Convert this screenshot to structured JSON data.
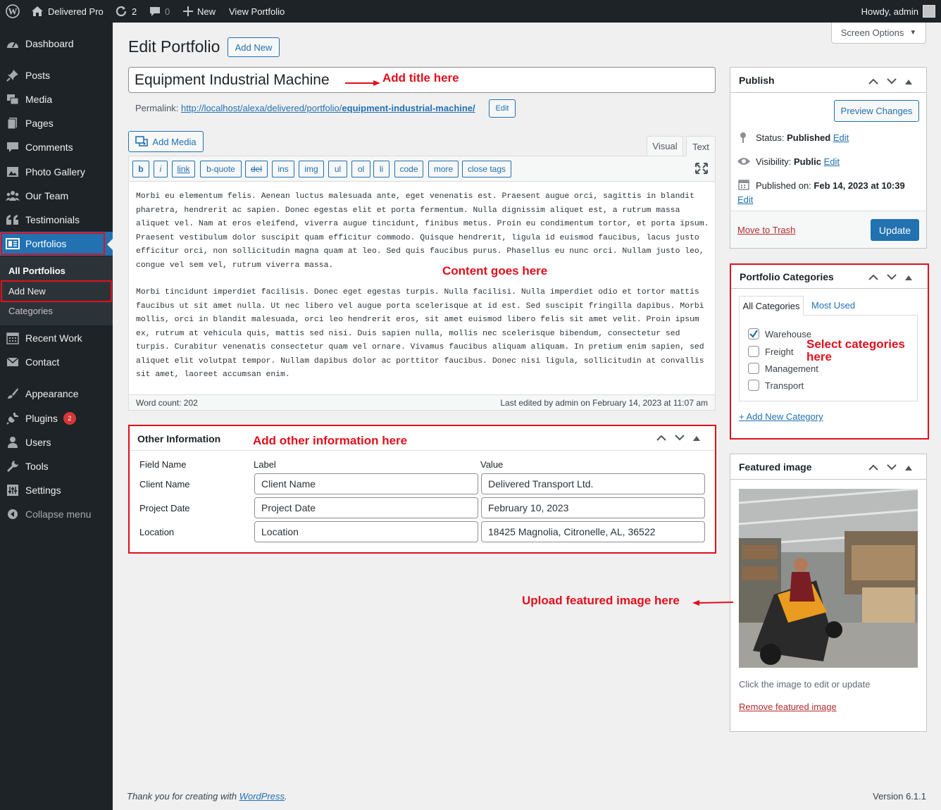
{
  "adminbar": {
    "site_name": "Delivered Pro",
    "updates_count": "2",
    "comments_count": "0",
    "new_label": "New",
    "view_label": "View Portfolio",
    "howdy": "Howdy, admin"
  },
  "sidebar": {
    "items": [
      {
        "label": "Dashboard",
        "icon": "dashboard-icon"
      },
      {
        "label": "Posts",
        "icon": "pin-icon"
      },
      {
        "label": "Media",
        "icon": "media-icon"
      },
      {
        "label": "Pages",
        "icon": "pages-icon"
      },
      {
        "label": "Comments",
        "icon": "comments-icon"
      },
      {
        "label": "Photo Gallery",
        "icon": "gallery-icon"
      },
      {
        "label": "Our Team",
        "icon": "team-icon"
      },
      {
        "label": "Testimonials",
        "icon": "quote-icon"
      },
      {
        "label": "Portfolios",
        "icon": "portfolio-icon"
      },
      {
        "label": "Recent Work",
        "icon": "calendar-icon"
      },
      {
        "label": "Contact",
        "icon": "mail-icon"
      },
      {
        "label": "Appearance",
        "icon": "brush-icon"
      },
      {
        "label": "Plugins",
        "icon": "plug-icon",
        "badge": "2"
      },
      {
        "label": "Users",
        "icon": "user-icon"
      },
      {
        "label": "Tools",
        "icon": "wrench-icon"
      },
      {
        "label": "Settings",
        "icon": "settings-icon"
      },
      {
        "label": "Collapse menu",
        "icon": "collapse-icon"
      }
    ],
    "submenu": [
      "All Portfolios",
      "Add New",
      "Categories"
    ]
  },
  "screen_options": "Screen Options",
  "page": {
    "title": "Edit Portfolio",
    "add_new": "Add New",
    "post_title": "Equipment Industrial Machine",
    "permalink_label": "Permalink:",
    "permalink_base": "http://localhost/alexa/delivered/portfolio/",
    "permalink_slug": "equipment-industrial-machine/",
    "permalink_edit": "Edit"
  },
  "editor": {
    "add_media": "Add Media",
    "tab_visual": "Visual",
    "tab_text": "Text",
    "quicktags": [
      "b",
      "i",
      "link",
      "b-quote",
      "del",
      "ins",
      "img",
      "ul",
      "ol",
      "li",
      "code",
      "more",
      "close tags"
    ],
    "paragraph1": "Morbi eu elementum felis. Aenean luctus malesuada ante, eget venenatis est. Praesent augue orci, sagittis in blandit pharetra, hendrerit ac sapien. Donec egestas elit et porta fermentum. Nulla dignissim aliquet est, a rutrum massa aliquet vel. Nam at eros eleifend, viverra augue tincidunt, finibus metus. Proin eu condimentum tortor, et porta ipsum. Praesent vestibulum dolor suscipit quam efficitur commodo. Quisque hendrerit, ligula id euismod faucibus, lacus justo efficitur orci, non sollicitudin magna quam at leo. Sed quis faucibus purus. Phasellus eu nunc orci. Nullam justo leo, congue vel sem vel, rutrum viverra massa.",
    "paragraph2": "Morbi tincidunt imperdiet facilisis. Donec eget egestas turpis. Nulla facilisi. Nulla imperdiet odio et tortor mattis faucibus ut sit amet nulla. Ut nec libero vel augue porta scelerisque at id est. Sed suscipit fringilla dapibus. Morbi mollis, orci in blandit malesuada, orci leo hendrerit eros, sit amet euismod libero felis sit amet velit. Proin ipsum ex, rutrum at vehicula quis, mattis sed nisi. Duis sapien nulla, mollis nec scelerisque bibendum, consectetur sed turpis. Curabitur venenatis consectetur quam vel ornare. Vivamus faucibus aliquam aliquam. In pretium enim sapien, sed aliquet elit volutpat tempor. Nullam dapibus dolor ac porttitor faucibus. Donec nisi ligula, sollicitudin at convallis sit amet, laoreet accumsan enim.",
    "word_count": "Word count: 202",
    "last_edited": "Last edited by admin on February 14, 2023 at 11:07 am"
  },
  "other_info": {
    "title": "Other Information",
    "col_field": "Field Name",
    "col_label": "Label",
    "col_value": "Value",
    "rows": [
      {
        "field": "Client Name",
        "label": "Client Name",
        "value": "Delivered Transport Ltd."
      },
      {
        "field": "Project Date",
        "label": "Project Date",
        "value": "February 10, 2023"
      },
      {
        "field": "Location",
        "label": "Location",
        "value": "18425 Magnolia, Citronelle, AL, 36522"
      }
    ]
  },
  "publish": {
    "title": "Publish",
    "preview": "Preview Changes",
    "status_label": "Status:",
    "status_value": "Published",
    "visibility_label": "Visibility:",
    "visibility_value": "Public",
    "published_label": "Published on:",
    "published_value": "Feb 14, 2023 at 10:39",
    "edit": "Edit",
    "trash": "Move to Trash",
    "update": "Update"
  },
  "categories": {
    "title": "Portfolio Categories",
    "tab_all": "All Categories",
    "tab_used": "Most Used",
    "items": [
      {
        "label": "Warehouse",
        "checked": true
      },
      {
        "label": "Freight",
        "checked": false
      },
      {
        "label": "Management",
        "checked": false
      },
      {
        "label": "Transport",
        "checked": false
      }
    ],
    "add_new": "+ Add New Category"
  },
  "featured": {
    "title": "Featured image",
    "hint": "Click the image to edit or update",
    "remove": "Remove featured image"
  },
  "annotations": {
    "title": "Add title here",
    "content": "Content goes here",
    "other": "Add other information here",
    "categories_line1": "Select categories",
    "categories_line2": "here",
    "featured": "Upload featured image here"
  },
  "footer": {
    "thanks_prefix": "Thank you for creating with ",
    "thanks_link": "WordPress",
    "thanks_suffix": ".",
    "version": "Version 6.1.1"
  },
  "colors": {
    "accent": "#2271b1",
    "annotation_red": "#e0101c",
    "sidebar_bg": "#1d2327"
  }
}
